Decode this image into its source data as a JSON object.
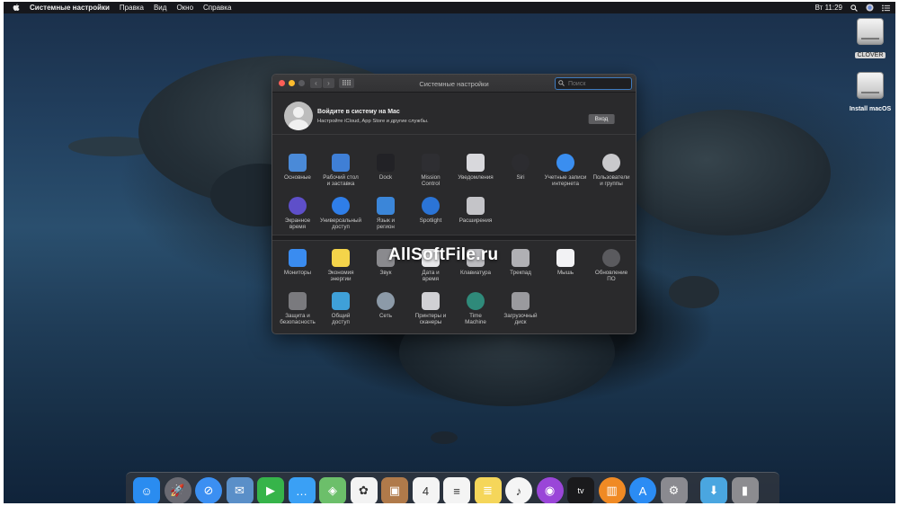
{
  "menubar": {
    "app_name": "Системные настройки",
    "items": [
      "Правка",
      "Вид",
      "Окно",
      "Справка"
    ],
    "clock": "Вт 11:29"
  },
  "desktop": {
    "icons": [
      {
        "label": "CLOVER",
        "selected": true
      },
      {
        "label": "Install macOS",
        "selected": false
      }
    ]
  },
  "window": {
    "title": "Системные настройки",
    "search": {
      "placeholder": "Поиск"
    },
    "account": {
      "title": "Войдите в систему на Mac",
      "subtitle": "Настройте iCloud, App Store и другие службы.",
      "login_label": "Вход"
    },
    "panes_top": [
      {
        "label": "Основные",
        "icon": "general-icon",
        "color": "#4a8ad8"
      },
      {
        "label": "Рабочий стол\nи заставка",
        "icon": "desktop-screensaver-icon",
        "color": "#3f7fd6"
      },
      {
        "label": "Dock",
        "icon": "dock-icon",
        "color": "#222226"
      },
      {
        "label": "Mission\nControl",
        "icon": "mission-control-icon",
        "color": "#2e2e32"
      },
      {
        "label": "Уведомления",
        "icon": "notifications-icon",
        "color": "#d8d8dc"
      },
      {
        "label": "Siri",
        "icon": "siri-icon",
        "color": "#2c2c30"
      },
      {
        "label": "Учетные записи\nинтернета",
        "icon": "internet-accounts-icon",
        "color": "#3a8ef0"
      },
      {
        "label": "Пользователи\nи группы",
        "icon": "users-groups-icon",
        "color": "#c9c9cc"
      },
      {
        "label": "Экранное\nвремя",
        "icon": "screen-time-icon",
        "color": "#5e4fc9"
      },
      {
        "label": "Универсальный\nдоступ",
        "icon": "accessibility-icon",
        "color": "#2f7ee8"
      },
      {
        "label": "Язык и\nрегион",
        "icon": "language-region-icon",
        "color": "#3b86d9"
      },
      {
        "label": "Spotlight",
        "icon": "spotlight-icon",
        "color": "#2b74d6"
      },
      {
        "label": "Расширения",
        "icon": "extensions-icon",
        "color": "#c4c4c8"
      }
    ],
    "panes_bottom": [
      {
        "label": "Мониторы",
        "icon": "displays-icon",
        "color": "#3a8cf0"
      },
      {
        "label": "Экономия\nэнергии",
        "icon": "energy-saver-icon",
        "color": "#f4d44a"
      },
      {
        "label": "Звук",
        "icon": "sound-icon",
        "color": "#8a8a8e"
      },
      {
        "label": "Дата и\nвремя",
        "icon": "date-time-icon",
        "color": "#e8e8ea"
      },
      {
        "label": "Клавиатура",
        "icon": "keyboard-icon",
        "color": "#bcbcc0"
      },
      {
        "label": "Трекпад",
        "icon": "trackpad-icon",
        "color": "#b0b0b4"
      },
      {
        "label": "Мышь",
        "icon": "mouse-icon",
        "color": "#f2f2f4"
      },
      {
        "label": "Обновление\nПО",
        "icon": "software-update-icon",
        "color": "#5a5a5e"
      },
      {
        "label": "Защита и\nбезопасность",
        "icon": "security-privacy-icon",
        "color": "#7a7a7e"
      },
      {
        "label": "Общий\nдоступ",
        "icon": "sharing-icon",
        "color": "#3fa0d8"
      },
      {
        "label": "Сеть",
        "icon": "network-icon",
        "color": "#8c9aa8"
      },
      {
        "label": "Принтеры и\nсканеры",
        "icon": "printers-scanners-icon",
        "color": "#d0d0d4"
      },
      {
        "label": "Time\nMachine",
        "icon": "time-machine-icon",
        "color": "#2f8a7a"
      },
      {
        "label": "Загрузочный\nдиск",
        "icon": "startup-disk-icon",
        "color": "#9a9a9e"
      }
    ]
  },
  "watermark": "AllSoftFile.ru",
  "dock": {
    "apps": [
      {
        "name": "finder-icon",
        "color": "#2a8cf0",
        "glyph": "☺"
      },
      {
        "name": "launchpad-icon",
        "color": "#6a6a72",
        "glyph": "🚀"
      },
      {
        "name": "safari-icon",
        "color": "#3b8ff2",
        "glyph": "⊘"
      },
      {
        "name": "mail-icon",
        "color": "#5a8fc8",
        "glyph": "✉"
      },
      {
        "name": "facetime-icon",
        "color": "#36b44a",
        "glyph": "▶"
      },
      {
        "name": "messages-icon",
        "color": "#3aa0f5",
        "glyph": "…"
      },
      {
        "name": "maps-icon",
        "color": "#6cbf6a",
        "glyph": "◈"
      },
      {
        "name": "photos-icon",
        "color": "#f3f3f3",
        "glyph": "✿"
      },
      {
        "name": "contacts-icon",
        "color": "#b07a4a",
        "glyph": "▣"
      },
      {
        "name": "calendar-icon",
        "color": "#f4f4f4",
        "glyph": "4"
      },
      {
        "name": "reminders-icon",
        "color": "#f4f4f4",
        "glyph": "≡"
      },
      {
        "name": "notes-icon",
        "color": "#f5d65a",
        "glyph": "≣"
      },
      {
        "name": "music-icon",
        "color": "#f5f5f5",
        "glyph": "♪"
      },
      {
        "name": "podcasts-icon",
        "color": "#9a46d8",
        "glyph": "◉"
      },
      {
        "name": "tv-icon",
        "color": "#1a1a1c",
        "glyph": "tv"
      },
      {
        "name": "books-icon",
        "color": "#f08a24",
        "glyph": "▥"
      },
      {
        "name": "app-store-icon",
        "color": "#2b8cf4",
        "glyph": "A"
      },
      {
        "name": "system-preferences-icon",
        "color": "#8a8a90",
        "glyph": "⚙"
      },
      {
        "name": "downloads-folder-icon",
        "color": "#4aa6e0",
        "glyph": "⬇"
      },
      {
        "name": "trash-icon",
        "color": "#8c8c90",
        "glyph": "▮"
      }
    ]
  }
}
